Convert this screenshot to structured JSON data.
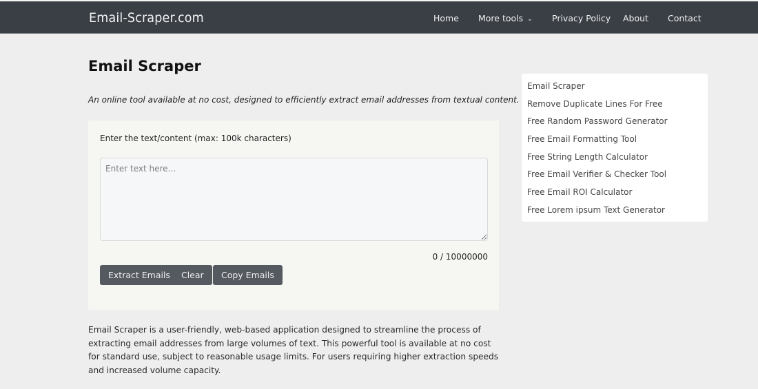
{
  "navbar": {
    "brand": "Email-Scraper.com",
    "links": [
      {
        "label": "Home"
      },
      {
        "label": "More tools",
        "has_dropdown": true,
        "icon": "chevron-down-icon"
      },
      {
        "label": "Privacy Policy"
      },
      {
        "label": "About"
      },
      {
        "label": "Contact"
      }
    ],
    "chevron_glyph": "⌄"
  },
  "main": {
    "title": "Email Scraper",
    "subtitle": "An online tool available at no cost, designed to efficiently extract email addresses from textual content.",
    "form": {
      "label": "Enter the text/content (max: 100k characters)",
      "textarea_value": "",
      "textarea_placeholder": "Enter text here...",
      "char_count": "0 / 10000000",
      "buttons": {
        "extract": "Extract Emails",
        "clear": "Clear",
        "copy": "Copy Emails"
      }
    },
    "description": "Email Scraper is a user-friendly, web-based application designed to streamline the process of extracting email addresses from large volumes of text. This powerful tool is available at no cost for standard use, subject to reasonable usage limits. For users requiring higher extraction speeds and increased volume capacity."
  },
  "sidebar": {
    "items": [
      {
        "label": "Email Scraper"
      },
      {
        "label": "Remove Duplicate Lines For Free"
      },
      {
        "label": "Free Random Password Generator"
      },
      {
        "label": "Free Email Formatting Tool"
      },
      {
        "label": "Free String Length Calculator"
      },
      {
        "label": "Free Email Verifier & Checker Tool"
      },
      {
        "label": "Free Email ROI Calculator"
      },
      {
        "label": "Free Lorem ipsum Text Generator"
      }
    ]
  },
  "colors": {
    "navbar_bg": "#3a3f46",
    "page_bg": "#eeeeee",
    "button_bg": "#555960",
    "card_bg": "#f6f6f3"
  }
}
